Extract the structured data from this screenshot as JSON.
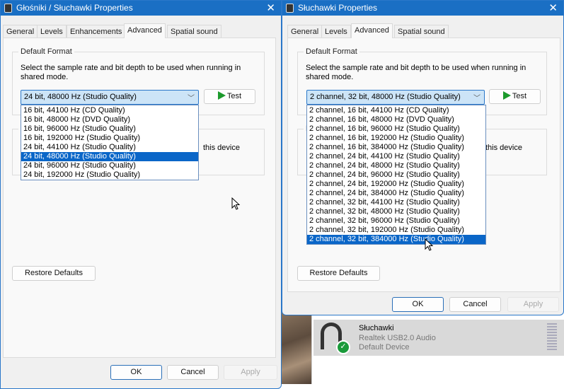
{
  "left_window": {
    "title": "Głośniki / Słuchawki Properties",
    "tabs": [
      "General",
      "Levels",
      "Enhancements",
      "Advanced",
      "Spatial sound"
    ],
    "active_tab": "Advanced",
    "group_title": "Default Format",
    "description": "Select the sample rate and bit depth to be used when running in shared mode.",
    "selected_format": "24 bit, 48000 Hz (Studio Quality)",
    "test_label": "Test",
    "options": [
      "16 bit, 44100 Hz (CD Quality)",
      "16 bit, 48000 Hz (DVD Quality)",
      "16 bit, 96000 Hz (Studio Quality)",
      "16 bit, 192000 Hz (Studio Quality)",
      "24 bit, 44100 Hz (Studio Quality)",
      "24 bit, 48000 Hz (Studio Quality)",
      "24 bit, 96000 Hz (Studio Quality)",
      "24 bit, 192000 Hz (Studio Quality)"
    ],
    "highlighted_index": 5,
    "group2_label_fragment": "E",
    "hidden_text_fragment": "this device",
    "restore_label": "Restore Defaults",
    "ok": "OK",
    "cancel": "Cancel",
    "apply": "Apply"
  },
  "right_window": {
    "title": "Słuchawki Properties",
    "tabs": [
      "General",
      "Levels",
      "Advanced",
      "Spatial sound"
    ],
    "active_tab": "Advanced",
    "group_title": "Default Format",
    "description": "Select the sample rate and bit depth to be used when running in shared mode.",
    "selected_format": "2 channel, 32 bit, 48000 Hz (Studio Quality)",
    "test_label": "Test",
    "options": [
      "2 channel, 16 bit, 44100 Hz (CD Quality)",
      "2 channel, 16 bit, 48000 Hz (DVD Quality)",
      "2 channel, 16 bit, 96000 Hz (Studio Quality)",
      "2 channel, 16 bit, 192000 Hz (Studio Quality)",
      "2 channel, 16 bit, 384000 Hz (Studio Quality)",
      "2 channel, 24 bit, 44100 Hz (Studio Quality)",
      "2 channel, 24 bit, 48000 Hz (Studio Quality)",
      "2 channel, 24 bit, 96000 Hz (Studio Quality)",
      "2 channel, 24 bit, 192000 Hz (Studio Quality)",
      "2 channel, 24 bit, 384000 Hz (Studio Quality)",
      "2 channel, 32 bit, 44100 Hz (Studio Quality)",
      "2 channel, 32 bit, 48000 Hz (Studio Quality)",
      "2 channel, 32 bit, 96000 Hz (Studio Quality)",
      "2 channel, 32 bit, 192000 Hz (Studio Quality)",
      "2 channel, 32 bit, 384000 Hz (Studio Quality)"
    ],
    "highlighted_index": 14,
    "group2_label_fragment": "E",
    "hidden_text_fragment": "this device",
    "restore_label": "Restore Defaults",
    "ok": "OK",
    "cancel": "Cancel",
    "apply": "Apply"
  },
  "device": {
    "name": "Słuchawki",
    "driver": "Realtek USB2.0 Audio",
    "status": "Default Device"
  }
}
